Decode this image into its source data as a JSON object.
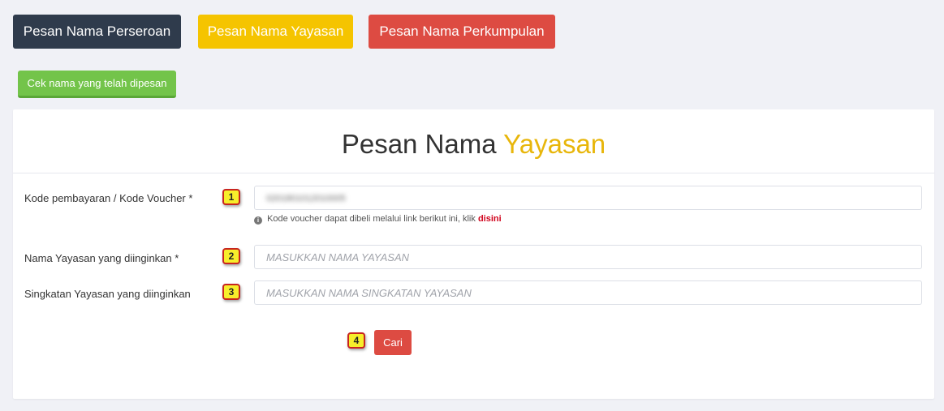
{
  "top_buttons": {
    "perseroan": "Pesan Nama Perseroan",
    "yayasan": "Pesan Nama Yayasan",
    "perkumpulan": "Pesan Nama Perkumpulan"
  },
  "cek_button": "Cek nama yang telah dipesan",
  "card": {
    "title_main": "Pesan Nama",
    "title_accent": "Yayasan"
  },
  "form": {
    "kode": {
      "label": "Kode pembayaran / Kode Voucher *",
      "badge": "1",
      "value": "0201801012010005"
    },
    "help": {
      "icon": "info-icon",
      "text": "Kode voucher dapat dibeli melalui link berikut ini, klik",
      "link": "disini"
    },
    "nama": {
      "label": "Nama Yayasan yang diinginkan *",
      "badge": "2",
      "placeholder": "MASUKKAN NAMA YAYASAN"
    },
    "singkatan": {
      "label": "Singkatan Yayasan yang diinginkan",
      "badge": "3",
      "placeholder": "MASUKKAN NAMA SINGKATAN YAYASAN"
    },
    "submit": {
      "badge": "4",
      "label": "Cari"
    }
  },
  "colors": {
    "dark": "#2f3b4c",
    "yellow": "#f5c400",
    "red": "#dd4b42",
    "green": "#73c44a",
    "accent_title": "#e8b60b",
    "link_red": "#d0021b"
  }
}
